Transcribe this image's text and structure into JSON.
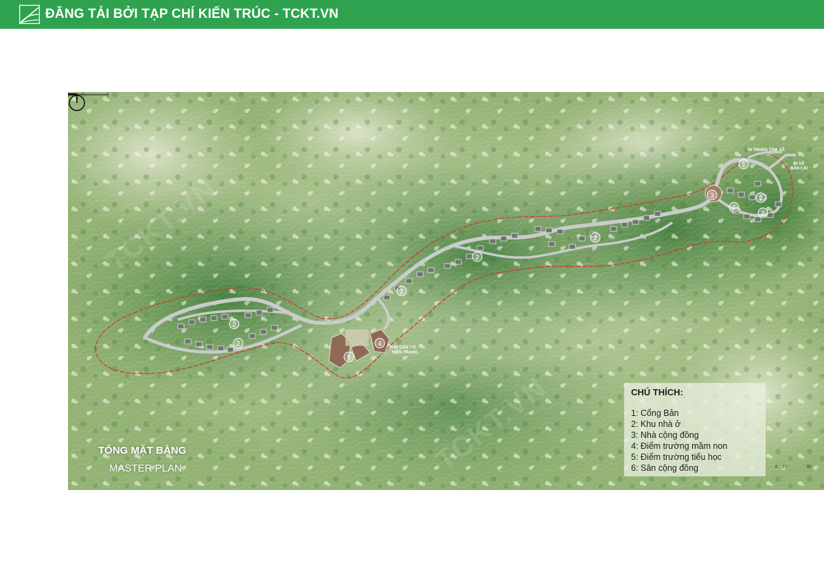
{
  "header": {
    "title": "ĐĂNG TẢI BỞI TẠP CHÍ KIẾN TRÚC - TCKT.VN",
    "background_color": "#2fa24f",
    "logo_icon": "tckt-logo-icon"
  },
  "plan": {
    "title": "TỔNG MẶT BẰNG",
    "subtitle": "MASTER PLAN",
    "watermark": "TCKT.VN",
    "site_boundary_color": "#d23a2a",
    "road_color": "#c9cccb"
  },
  "road_labels": {
    "to_commune_center": "ĐI TRUNG TÂM XÃ",
    "to_ban_cai": [
      "ĐI XÃ",
      "BẢN CÁI"
    ],
    "to_existing_residents": [
      "ĐI DÂN CƯ",
      "HIỆN TRẠNG"
    ]
  },
  "markers": [
    "1",
    "2",
    "2",
    "2",
    "2",
    "2",
    "2",
    "2",
    "3",
    "4",
    "5",
    "6"
  ],
  "legend": {
    "title": "CHÚ THÍCH:",
    "items": [
      "1: Cổng Bản",
      "2: Khu nhà ở",
      "3: Nhà cộng đồng",
      "4: Điểm trường mầm non",
      "5: Điểm trường tiểu học",
      "6: Sân cộng đồng"
    ]
  },
  "scale": {
    "labels": [
      "0",
      "10",
      "50"
    ],
    "icon": "north-arrow-icon"
  }
}
